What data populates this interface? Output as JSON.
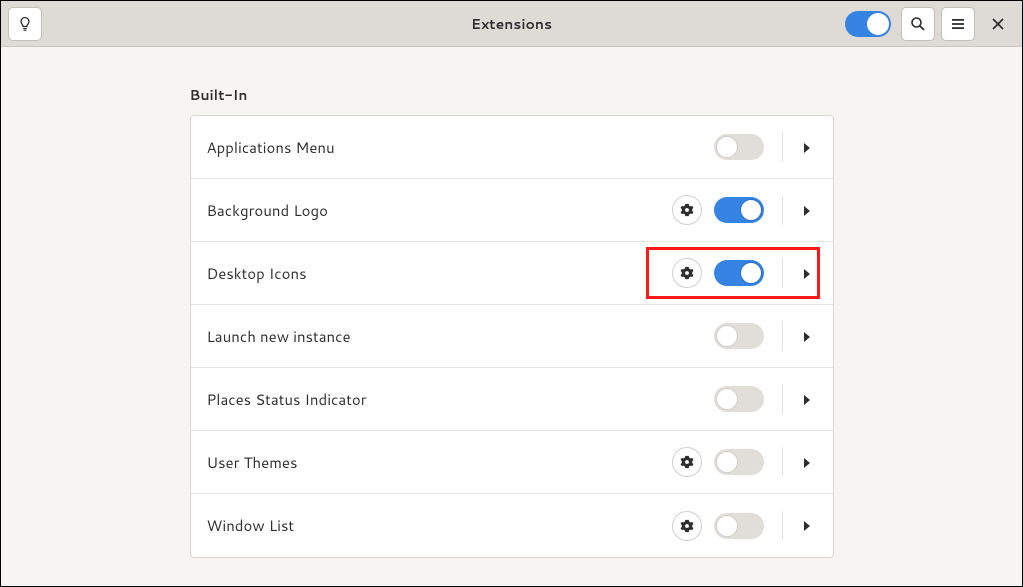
{
  "header": {
    "title": "Extensions",
    "master_switch": true
  },
  "section_title": "Built-In",
  "extensions": [
    {
      "name": "Applications Menu",
      "has_settings": false,
      "enabled": false
    },
    {
      "name": "Background Logo",
      "has_settings": true,
      "enabled": true
    },
    {
      "name": "Desktop Icons",
      "has_settings": true,
      "enabled": true,
      "highlighted": true
    },
    {
      "name": "Launch new instance",
      "has_settings": false,
      "enabled": false
    },
    {
      "name": "Places Status Indicator",
      "has_settings": false,
      "enabled": false
    },
    {
      "name": "User Themes",
      "has_settings": true,
      "enabled": false
    },
    {
      "name": "Window List",
      "has_settings": true,
      "enabled": false
    }
  ]
}
